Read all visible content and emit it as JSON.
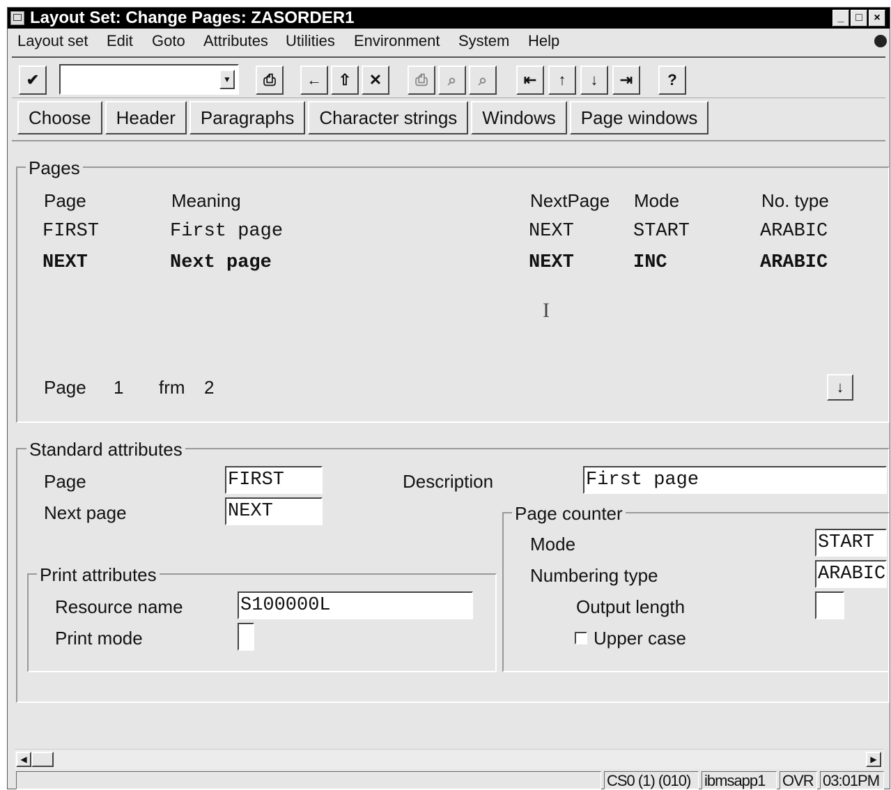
{
  "window": {
    "title": "Layout Set: Change Pages: ZASORDER1",
    "controls": [
      "_",
      "□",
      "×"
    ]
  },
  "menu": {
    "items": [
      "Layout set",
      "Edit",
      "Goto",
      "Attributes",
      "Utilities",
      "Environment",
      "System",
      "Help"
    ]
  },
  "toolbar": {
    "command_value": "",
    "icons": [
      "enter-check-icon",
      "save-icon",
      "back-icon",
      "exit-icon",
      "cancel-icon",
      "print-icon",
      "find-icon",
      "find-next-icon",
      "first-page-icon",
      "previous-page-icon",
      "next-page-icon",
      "last-page-icon",
      "help-icon"
    ]
  },
  "appbar": {
    "buttons": [
      "Choose",
      "Header",
      "Paragraphs",
      "Character strings",
      "Windows",
      "Page windows"
    ]
  },
  "pages": {
    "title": "Pages",
    "headers": {
      "page": "Page",
      "meaning": "Meaning",
      "nextpage": "NextPage",
      "mode": "Mode",
      "notype": "No. type"
    },
    "rows": [
      {
        "page": "FIRST",
        "meaning": "First page",
        "nextpage": "NEXT",
        "mode": "START",
        "notype": "ARABIC"
      },
      {
        "page": "NEXT",
        "meaning": "Next page",
        "nextpage": "NEXT",
        "mode": "INC",
        "notype": "ARABIC"
      }
    ],
    "pager": {
      "label": "Page",
      "current": "1",
      "frm_label": "frm",
      "total": "2"
    }
  },
  "standard": {
    "title": "Standard attributes",
    "page_label": "Page",
    "page_value": "FIRST",
    "next_label": "Next page",
    "next_value": "NEXT",
    "desc_label": "Description",
    "desc_value": "First page"
  },
  "print": {
    "title": "Print attributes",
    "resource_label": "Resource name",
    "resource_value": "S100000L",
    "mode_label": "Print mode",
    "mode_value": ""
  },
  "counter": {
    "title": "Page counter",
    "mode_label": "Mode",
    "mode_value": "START",
    "numbering_label": "Numbering type",
    "numbering_value": "ARABIC",
    "length_label": "Output length",
    "length_value": "",
    "upper_label": "Upper case",
    "upper_checked": false
  },
  "status": {
    "system": "CS0 (1) (010)",
    "server": "ibmsapp1",
    "mode": "OVR",
    "time": "03:01PM"
  }
}
